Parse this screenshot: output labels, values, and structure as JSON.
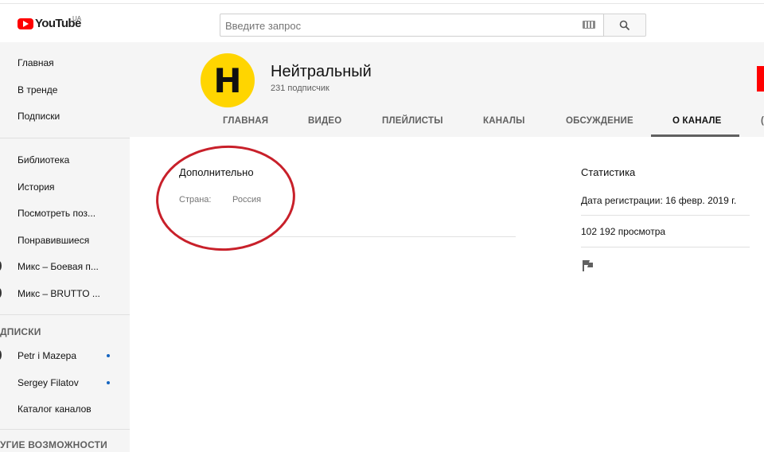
{
  "masthead": {
    "logo_text": "YouTube",
    "region": "UA",
    "search_placeholder": "Введите запрос"
  },
  "sidebar": {
    "items": [
      {
        "label": "Главная"
      },
      {
        "label": "В тренде"
      },
      {
        "label": "Подписки"
      }
    ],
    "library": [
      {
        "label": "Библиотека"
      },
      {
        "label": "История"
      },
      {
        "label": "Посмотреть поз..."
      },
      {
        "label": "Понравившиеся"
      },
      {
        "label": "Микс – Боевая п..."
      },
      {
        "label": "Микс – BRUTTO ..."
      }
    ],
    "subscriptions_heading": "ДПИСКИ",
    "subscriptions": [
      {
        "label": "Petr i Mazepa"
      },
      {
        "label": "Sergey Filatov"
      },
      {
        "label": "Каталог каналов"
      }
    ],
    "more_heading": "УГИЕ ВОЗМОЖНОСТИ"
  },
  "channel": {
    "avatar_letter": "Н",
    "name": "Нейтральный",
    "subscribers": "231 подписчик",
    "tabs": [
      {
        "label": "ГЛАВНАЯ"
      },
      {
        "label": "ВИДЕО"
      },
      {
        "label": "ПЛЕЙЛИСТЫ"
      },
      {
        "label": "КАНАЛЫ"
      },
      {
        "label": "ОБСУЖДЕНИЕ"
      },
      {
        "label": "О КАНАЛЕ"
      },
      {
        "label": "("
      }
    ],
    "active_tab": "О КАНАЛЕ"
  },
  "about": {
    "details_title": "Дополнительно",
    "country_label": "Страна:",
    "country_value": "Россия"
  },
  "stats": {
    "title": "Статистика",
    "joined": "Дата регистрации: 16 февр. 2019 г.",
    "views": "102 192 просмотра"
  },
  "colors": {
    "brand_red": "#ff0000",
    "avatar_yellow": "#ffd500",
    "annotation_red": "#c8202a",
    "sidebar_bg": "#f5f5f5"
  }
}
